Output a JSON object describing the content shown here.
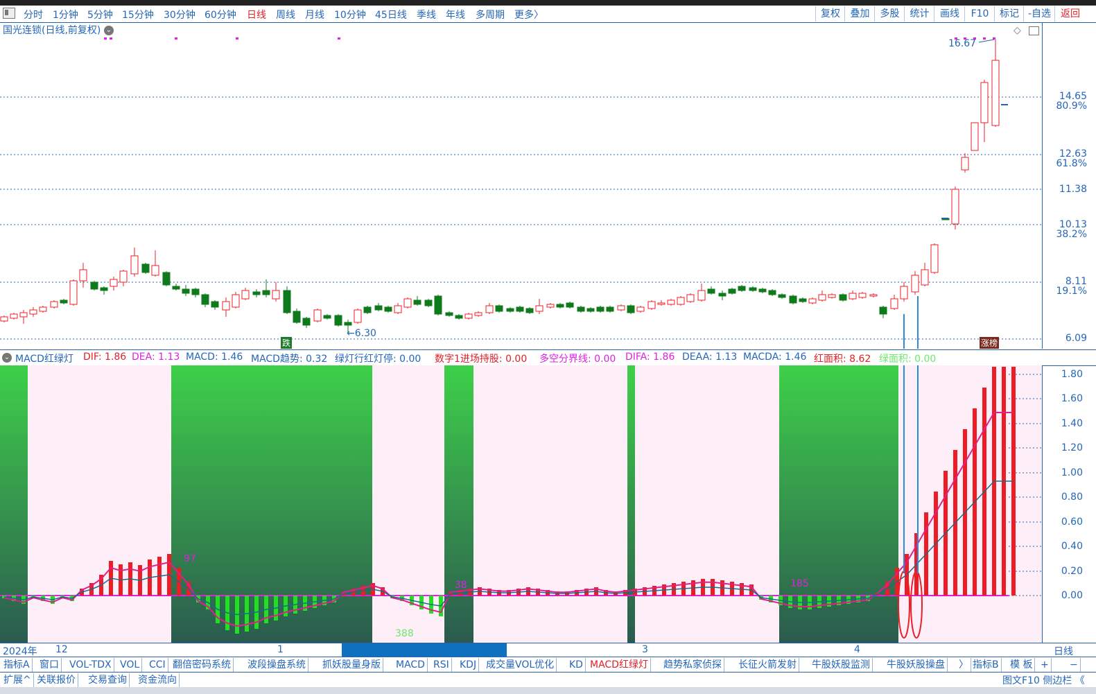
{
  "periods": [
    "分时",
    "1分钟",
    "5分钟",
    "15分钟",
    "30分钟",
    "60分钟",
    "日线",
    "周线",
    "月线",
    "10分钟",
    "45日线",
    "季线",
    "年线",
    "多周期",
    "更多〉"
  ],
  "active_period": "日线",
  "right_buttons": [
    "复权",
    "叠加",
    "多股",
    "统计",
    "画线",
    "F10",
    "标记",
    "-自选",
    "返回"
  ],
  "stock_title": "国光连锁(日线,前复权)",
  "price_labels": [
    {
      "text": "14.65",
      "sub": "80.9%"
    },
    {
      "text": "12.63",
      "sub": "61.8%"
    },
    {
      "text": "11.38",
      "sub": ""
    },
    {
      "text": "10.13",
      "sub": "38.2%"
    },
    {
      "text": "8.11",
      "sub": "19.1%"
    },
    {
      "text": "6.09",
      "sub": ""
    }
  ],
  "high_label": "16.67",
  "low_label": "6.30",
  "tag_die": "跌",
  "tag_zhangbang": "涨榜",
  "indicator_line": [
    {
      "text": "MACD红绿灯",
      "color": "#2466b8"
    },
    {
      "text": "DIF: 1.86",
      "color": "#e0202a"
    },
    {
      "text": "DEA: 1.13",
      "color": "#e020e0"
    },
    {
      "text": "MACD: 1.46",
      "color": "#2466b8"
    },
    {
      "text": "MACD趋势: 0.32",
      "color": "#2466b8"
    },
    {
      "text": "绿灯行红灯停: 0.00",
      "color": "#2466b8"
    },
    {
      "text": "数字1进场持股: 0.00",
      "color": "#e0202a"
    },
    {
      "text": "多空分界线: 0.00",
      "color": "#e020e0"
    },
    {
      "text": "DIFA: 1.86",
      "color": "#e020e0"
    },
    {
      "text": "DEAA: 1.13",
      "color": "#2466b8"
    },
    {
      "text": "MACDA: 1.46",
      "color": "#2466b8"
    },
    {
      "text": "红面积: 8.62",
      "color": "#e0202a"
    },
    {
      "text": "绿面积: 0.00",
      "color": "#6ee86e"
    }
  ],
  "sub_axis_labels": [
    "1.80",
    "1.60",
    "1.40",
    "1.20",
    "1.00",
    "0.80",
    "0.60",
    "0.40",
    "0.20",
    "0.00"
  ],
  "sub_annotations": {
    "a38": "38",
    "a388": "388",
    "a185": "185",
    "a97": "97"
  },
  "date_labels": [
    "2024年",
    "12",
    "1",
    "3",
    "4"
  ],
  "period_name": "日线",
  "tabs": [
    "指标A",
    "窗口",
    "VOL-TDX",
    "VOL",
    "CCI",
    "翻倍密码系统",
    "波段操盘系统",
    "抓妖股量身版",
    "MACD",
    "RSI",
    "KDJ",
    "成交量VOL优化",
    "KD",
    "MACD红绿灯",
    "趋势私家侦探",
    "长征火箭发射",
    "牛股妖股监测",
    "牛股妖股操盘",
    "〉",
    "指标B",
    "模 板",
    "+",
    "−"
  ],
  "active_tab": "MACD红绿灯",
  "bottom_items": [
    "扩展^",
    "关联报价",
    "交易查询",
    "资金流向"
  ],
  "bottom_right": "图文F10 侧边栏 《"
}
